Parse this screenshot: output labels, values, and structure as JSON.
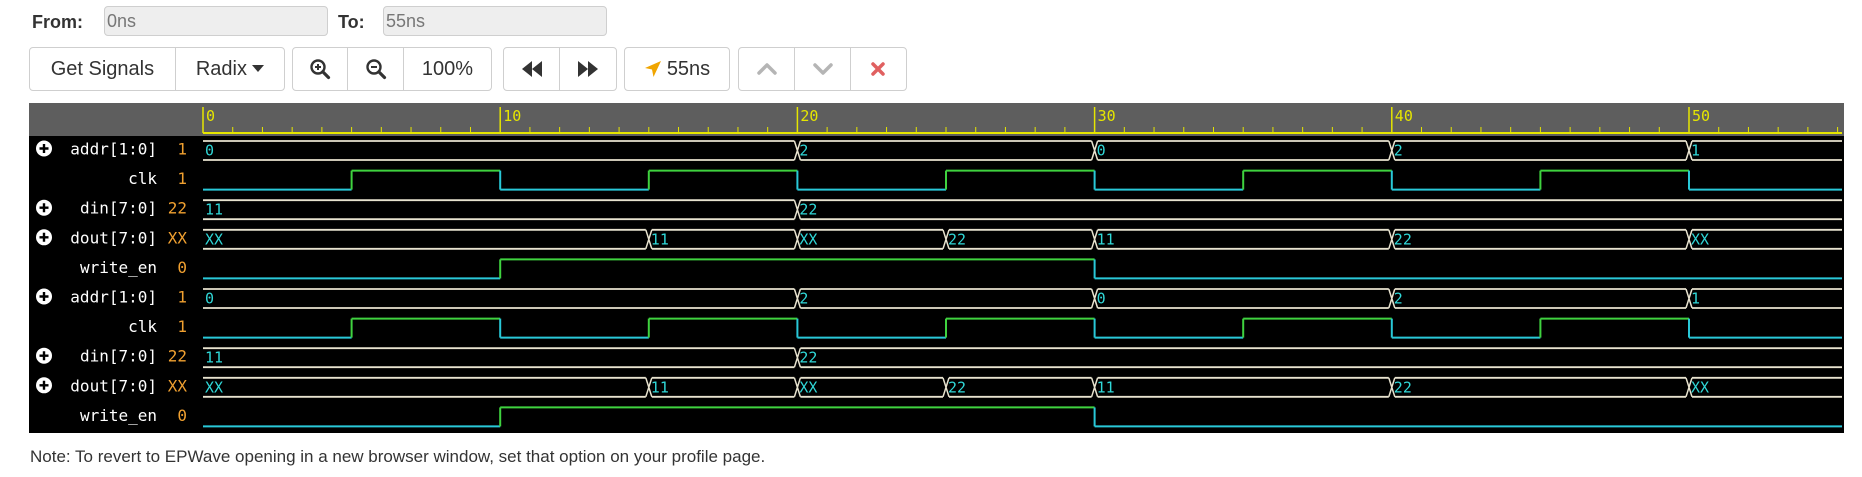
{
  "range": {
    "from_label": "From:",
    "from_value": "0ns",
    "to_label": "To:",
    "to_value": "55ns"
  },
  "toolbar": {
    "get_signals": "Get Signals",
    "radix": "Radix",
    "zoom_level": "100%",
    "cursor_time": "55ns",
    "icons": {
      "zoom_in": "zoom-in-icon",
      "zoom_out": "zoom-out-icon",
      "prev": "fast-backward-icon",
      "next": "fast-forward-icon",
      "cursor": "location-arrow-icon",
      "up": "chevron-up-icon",
      "down": "chevron-down-icon",
      "remove": "close-icon"
    }
  },
  "waveform": {
    "time_range": [
      0,
      59
    ],
    "ruler_labels": [
      "0",
      "10",
      "20",
      "30",
      "40",
      "50"
    ],
    "colors": {
      "background": "#000000",
      "ruler": "#5e5e5e",
      "ruler_ticks": "#e6e600",
      "bus": "#e8e3cf",
      "bus_text": "#30d8d8",
      "clock_high": "#3fd23f",
      "clock_low": "#29c8d8",
      "value": "#f0a030",
      "name": "#ffffff"
    },
    "signals": [
      {
        "name": "addr[1:0]",
        "value": "1",
        "type": "bus",
        "expandable": true,
        "segments": [
          {
            "t": 0,
            "v": "0"
          },
          {
            "t": 20,
            "v": "2"
          },
          {
            "t": 30,
            "v": "0"
          },
          {
            "t": 40,
            "v": "2"
          },
          {
            "t": 50,
            "v": "1"
          }
        ]
      },
      {
        "name": "clk",
        "value": "1",
        "type": "clock",
        "expandable": false,
        "edges": [
          {
            "t": 0,
            "level": 0
          },
          {
            "t": 5,
            "level": 1
          },
          {
            "t": 10,
            "level": 0
          },
          {
            "t": 15,
            "level": 1
          },
          {
            "t": 20,
            "level": 0
          },
          {
            "t": 25,
            "level": 1
          },
          {
            "t": 30,
            "level": 0
          },
          {
            "t": 35,
            "level": 1
          },
          {
            "t": 40,
            "level": 0
          },
          {
            "t": 45,
            "level": 1
          },
          {
            "t": 50,
            "level": 0
          }
        ]
      },
      {
        "name": "din[7:0]",
        "value": "22",
        "type": "bus",
        "expandable": true,
        "segments": [
          {
            "t": 0,
            "v": "11"
          },
          {
            "t": 20,
            "v": "22"
          }
        ]
      },
      {
        "name": "dout[7:0]",
        "value": "XX",
        "type": "bus",
        "expandable": true,
        "segments": [
          {
            "t": 0,
            "v": "XX"
          },
          {
            "t": 15,
            "v": "11"
          },
          {
            "t": 20,
            "v": "XX"
          },
          {
            "t": 25,
            "v": "22"
          },
          {
            "t": 30,
            "v": "11"
          },
          {
            "t": 40,
            "v": "22"
          },
          {
            "t": 50,
            "v": "XX"
          }
        ]
      },
      {
        "name": "write_en",
        "value": "0",
        "type": "wire",
        "expandable": false,
        "edges": [
          {
            "t": 0,
            "level": 0
          },
          {
            "t": 10,
            "level": 1
          },
          {
            "t": 30,
            "level": 0
          }
        ]
      },
      {
        "name": "addr[1:0]",
        "value": "1",
        "type": "bus",
        "expandable": true,
        "segments": [
          {
            "t": 0,
            "v": "0"
          },
          {
            "t": 20,
            "v": "2"
          },
          {
            "t": 30,
            "v": "0"
          },
          {
            "t": 40,
            "v": "2"
          },
          {
            "t": 50,
            "v": "1"
          }
        ]
      },
      {
        "name": "clk",
        "value": "1",
        "type": "clock",
        "expandable": false,
        "edges": [
          {
            "t": 0,
            "level": 0
          },
          {
            "t": 5,
            "level": 1
          },
          {
            "t": 10,
            "level": 0
          },
          {
            "t": 15,
            "level": 1
          },
          {
            "t": 20,
            "level": 0
          },
          {
            "t": 25,
            "level": 1
          },
          {
            "t": 30,
            "level": 0
          },
          {
            "t": 35,
            "level": 1
          },
          {
            "t": 40,
            "level": 0
          },
          {
            "t": 45,
            "level": 1
          },
          {
            "t": 50,
            "level": 0
          }
        ]
      },
      {
        "name": "din[7:0]",
        "value": "22",
        "type": "bus",
        "expandable": true,
        "segments": [
          {
            "t": 0,
            "v": "11"
          },
          {
            "t": 20,
            "v": "22"
          }
        ]
      },
      {
        "name": "dout[7:0]",
        "value": "XX",
        "type": "bus",
        "expandable": true,
        "segments": [
          {
            "t": 0,
            "v": "XX"
          },
          {
            "t": 15,
            "v": "11"
          },
          {
            "t": 20,
            "v": "XX"
          },
          {
            "t": 25,
            "v": "22"
          },
          {
            "t": 30,
            "v": "11"
          },
          {
            "t": 40,
            "v": "22"
          },
          {
            "t": 50,
            "v": "XX"
          }
        ]
      },
      {
        "name": "write_en",
        "value": "0",
        "type": "wire",
        "expandable": false,
        "edges": [
          {
            "t": 0,
            "level": 0
          },
          {
            "t": 10,
            "level": 1
          },
          {
            "t": 30,
            "level": 0
          }
        ]
      }
    ]
  },
  "note": "Note: To revert to EPWave opening in a new browser window, set that option on your profile page."
}
